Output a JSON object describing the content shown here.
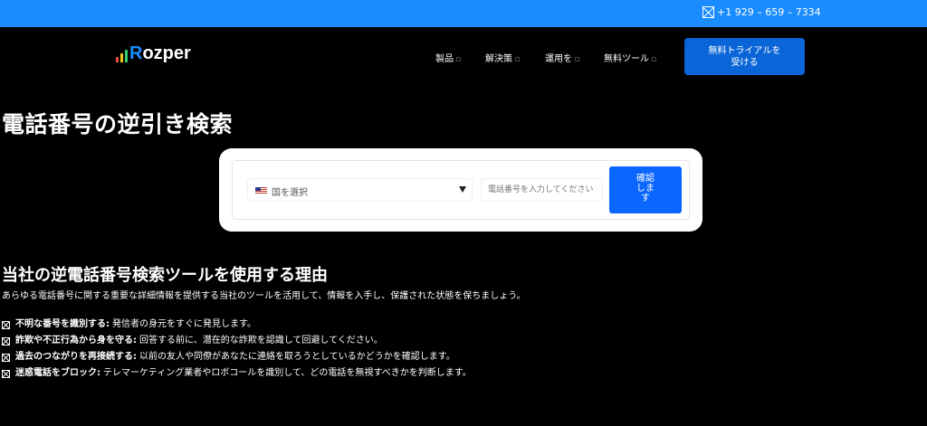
{
  "topbar": {
    "phone": "+1 929 – 659 – 7334",
    "phone_icon": "phone-icon"
  },
  "logo": {
    "prefix": "R",
    "rest": "ozper"
  },
  "nav": [
    {
      "label": "製品"
    },
    {
      "label": "解決策"
    },
    {
      "label": "運用を"
    },
    {
      "label": "無料ツール"
    }
  ],
  "cta": {
    "line1": "無料トライアルを",
    "line2": "受ける"
  },
  "hero": {
    "title": "電話番号の逆引き検索"
  },
  "search": {
    "country_label": "国を選択",
    "phone_placeholder": "電話番号を入力してください",
    "confirm_lines": [
      "確認",
      "しま",
      "す"
    ]
  },
  "why": {
    "title": "当社の逆電話番号検索ツールを使用する理由",
    "subtitle": "あらゆる電話番号に関する重要な詳細情報を提供する当社のツールを活用して、情報を入手し、保護された状態を保ちましょう。",
    "items": [
      {
        "bold": "不明な番号を識別する:",
        "text": "発信者の身元をすぐに発見します。"
      },
      {
        "bold": "詐欺や不正行為から身を守る:",
        "text": "回答する前に、潜在的な詐欺を認識して回避してください。"
      },
      {
        "bold": "過去のつながりを再接続する:",
        "text": "以前の友人や同僚があなたに連絡を取ろうとしているかどうかを確認します。"
      },
      {
        "bold": "迷惑電話をブロック:",
        "text": "テレマーケティング業者やロボコールを識別して、どの電話を無視すべきかを判断します。"
      }
    ]
  },
  "colors": {
    "topbar": "#1a8cff",
    "cta": "#0a66d8",
    "confirm": "#0a66ff",
    "background": "#000000"
  }
}
